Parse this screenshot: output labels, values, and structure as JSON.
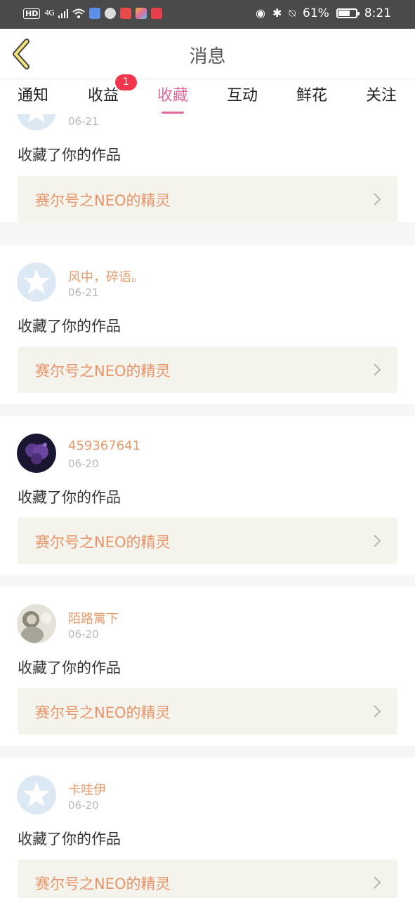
{
  "status_bar": {
    "network": "4G",
    "battery_percent": "61%",
    "battery_level": 0.61,
    "time": "8:21"
  },
  "header": {
    "title": "消息"
  },
  "tabs": [
    {
      "label": "通知"
    },
    {
      "label": "收益",
      "badge": "1"
    },
    {
      "label": "收藏",
      "active": true
    },
    {
      "label": "互动"
    },
    {
      "label": "鲜花"
    },
    {
      "label": "关注"
    }
  ],
  "feed": [
    {
      "username": "",
      "date": "06-21",
      "action": "收藏了你的作品",
      "work": "赛尔号之NEO的精灵",
      "avatar": "default-avatar"
    },
    {
      "username": "风中，碎语。",
      "date": "06-21",
      "action": "收藏了你的作品",
      "work": "赛尔号之NEO的精灵",
      "avatar": "default-avatar"
    },
    {
      "username": "459367641",
      "date": "06-20",
      "action": "收藏了你的作品",
      "work": "赛尔号之NEO的精灵",
      "avatar": "purple-art-avatar"
    },
    {
      "username": "陌路篱下",
      "date": "06-20",
      "action": "收藏了你的作品",
      "work": "赛尔号之NEO的精灵",
      "avatar": "photo-avatar"
    },
    {
      "username": "卡哇伊",
      "date": "06-20",
      "action": "收藏了你的作品",
      "work": "赛尔号之NEO的精灵",
      "avatar": "default-avatar"
    }
  ],
  "colors": {
    "accent": "#e06b9c",
    "username": "#e79a6a",
    "work_title": "#e7946a",
    "badge": "#f0364c"
  }
}
